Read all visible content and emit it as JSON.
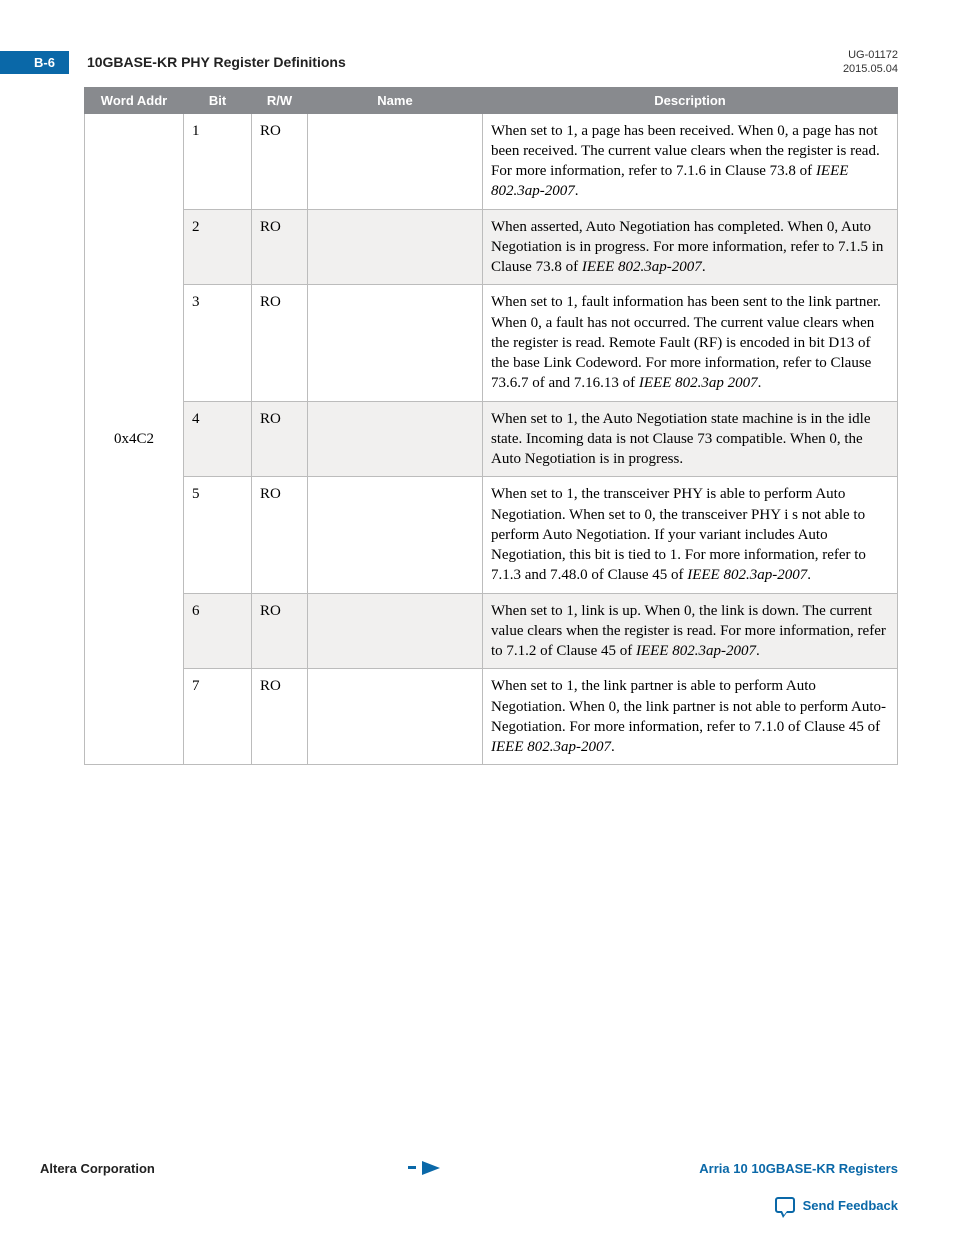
{
  "header": {
    "page_badge": "B-6",
    "section_title": "10GBASE-KR PHY Register Definitions",
    "doc_id": "UG-01172",
    "doc_date": "2015.05.04"
  },
  "table": {
    "headers": {
      "word_addr": "Word Addr",
      "bit": "Bit",
      "rw": "R/W",
      "name": "Name",
      "description": "Description"
    },
    "word_addr": "0x4C2",
    "rows": [
      {
        "bit": "1",
        "rw": "RO",
        "name": "",
        "desc_html": "When set to 1, a page has been received. When 0, a page has not been received. The current value clears when the register is read. For more information, refer to 7.1.6 in Clause 73.8 of <em>IEEE 802.3ap-2007</em>."
      },
      {
        "bit": "2",
        "rw": "RO",
        "name": "",
        "desc_html": "When asserted, Auto Negotiation has completed. When 0, Auto Negotiation is in progress. For more information, refer to 7.1.5 in Clause 73.8 of <em>IEEE 802.3ap-2007</em>."
      },
      {
        "bit": "3",
        "rw": "RO",
        "name": "",
        "desc_html": "When set to 1, fault information has been sent to the link partner. When 0, a fault has not occurred. The current value clears when the register is read. Remote Fault (RF) is encoded in bit D13 of the base Link Codeword. For more information, refer to Clause 73.6.7 of and 7.16.13 of <em>IEEE 802.3ap 2007</em>."
      },
      {
        "bit": "4",
        "rw": "RO",
        "name": "",
        "desc_html": "When set to 1, the Auto Negotiation state machine is in the idle state. Incoming data is not Clause 73 compatible. When 0, the Auto Negotiation is in progress."
      },
      {
        "bit": "5",
        "rw": "RO",
        "name": "",
        "desc_html": "When set to 1, the transceiver PHY is able to perform Auto Negotiation. When set to 0, the transceiver PHY i s not able to perform Auto Negotiation. If your variant includes Auto Negotiation, this bit is tied to 1. For more information, refer to 7.1.3 and 7.48.0 of Clause 45 of <em>IEEE 802.3ap-2007</em>."
      },
      {
        "bit": "6",
        "rw": "RO",
        "name": "",
        "desc_html": "When set to 1, link is up. When 0, the link is down. The current value clears when the register is read. For more information, refer to 7.1.2 of Clause 45 of <em>IEEE 802.3ap-2007</em>."
      },
      {
        "bit": "7",
        "rw": "RO",
        "name": "",
        "desc_html": "When set to 1, the link partner is able to perform Auto Negotiation. When 0, the link partner is not able to perform Auto-Negotiation. For more information, refer to 7.1.0 of Clause 45 of <em>IEEE 802.3ap-2007</em>."
      }
    ]
  },
  "footer": {
    "left": "Altera Corporation",
    "right": "Arria 10 10GBASE-KR Registers",
    "feedback": "Send Feedback"
  }
}
